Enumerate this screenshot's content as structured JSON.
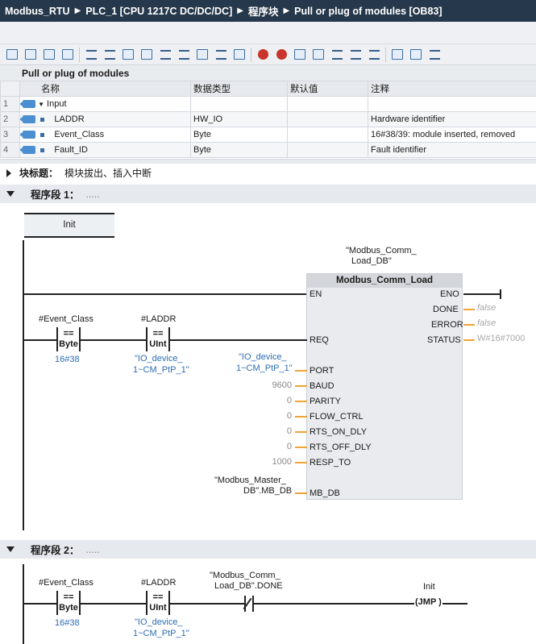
{
  "breadcrumb": [
    "Modbus_RTU",
    "PLC_1 [CPU 1217C DC/DC/DC]",
    "程序块",
    "Pull or plug of modules [OB83]"
  ],
  "interface": {
    "title": "Pull or plug of modules",
    "columns": [
      "名称",
      "数据类型",
      "默认值",
      "注释"
    ],
    "rows": [
      {
        "num": "1",
        "name": "Input",
        "type": "",
        "default": "",
        "comment": ""
      },
      {
        "num": "2",
        "name": "LADDR",
        "type": "HW_IO",
        "default": "",
        "comment": "Hardware identifier"
      },
      {
        "num": "3",
        "name": "Event_Class",
        "type": "Byte",
        "default": "",
        "comment": "16#38/39: module inserted, removed"
      },
      {
        "num": "4",
        "name": "Fault_ID",
        "type": "Byte",
        "default": "",
        "comment": "Fault identifier"
      }
    ]
  },
  "block_title": {
    "label": "块标题：",
    "text": "模块拔出、插入中断"
  },
  "network1": {
    "title": "程序段 1：",
    "dots": ".....",
    "label": "Init",
    "contact1": {
      "operand": "#Event_Class",
      "op": "==",
      "type": "Byte",
      "value": "16#38"
    },
    "contact2": {
      "operand": "#LADDR",
      "op": "==",
      "type": "UInt",
      "value1": "\"IO_device_",
      "value2": "1~CM_PtP_1\""
    },
    "fb_instance1": "\"Modbus_Comm_",
    "fb_instance2": "Load_DB\"",
    "fb_name": "Modbus_Comm_Load",
    "inputs": [
      "EN",
      "REQ",
      "PORT",
      "BAUD",
      "PARITY",
      "FLOW_CTRL",
      "RTS_ON_DLY",
      "RTS_OFF_DLY",
      "RESP_TO",
      "MB_DB"
    ],
    "outputs": [
      "ENO",
      "DONE",
      "ERROR",
      "STATUS"
    ],
    "port_val1": "\"IO_device_",
    "port_val2": "1~CM_PtP_1\"",
    "baud": "9600",
    "parity": "0",
    "flow": "0",
    "rts_on": "0",
    "rts_off": "0",
    "resp_to": "1000",
    "mbdb1": "\"Modbus_Master_",
    "mbdb2": "DB\".MB_DB",
    "done_val": "false",
    "error_val": "false",
    "status_val": "W#16#7000"
  },
  "network2": {
    "title": "程序段 2：",
    "dots": ".....",
    "contact1": {
      "operand": "#Event_Class",
      "op": "==",
      "type": "Byte",
      "value": "16#38"
    },
    "contact2": {
      "operand": "#LADDR",
      "op": "==",
      "type": "UInt",
      "value1": "\"IO_device_",
      "value2": "1~CM_PtP_1\""
    },
    "contact3_1": "\"Modbus_Comm_",
    "contact3_2": "Load_DB\".DONE",
    "jmp_label": "Init",
    "jmp": "(JMP )"
  }
}
